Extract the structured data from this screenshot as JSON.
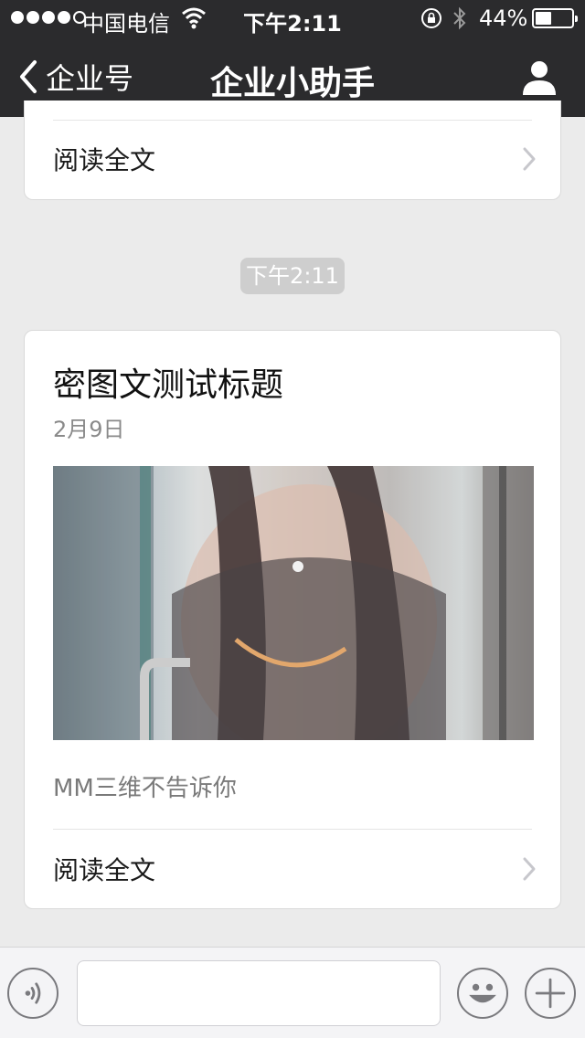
{
  "status_bar": {
    "carrier": "中国电信",
    "time": "下午2:11",
    "battery": "44%",
    "battery_level": 0.44
  },
  "nav": {
    "back_label": "企业号",
    "title": "企业小助手"
  },
  "messages": [
    {
      "read_more": "阅读全文"
    },
    {
      "timestamp": "下午2:11",
      "title": "密图文测试标题",
      "date": "2月9日",
      "summary": "MM三维不告诉你",
      "read_more": "阅读全文"
    }
  ],
  "input_bar": {
    "placeholder": ""
  }
}
